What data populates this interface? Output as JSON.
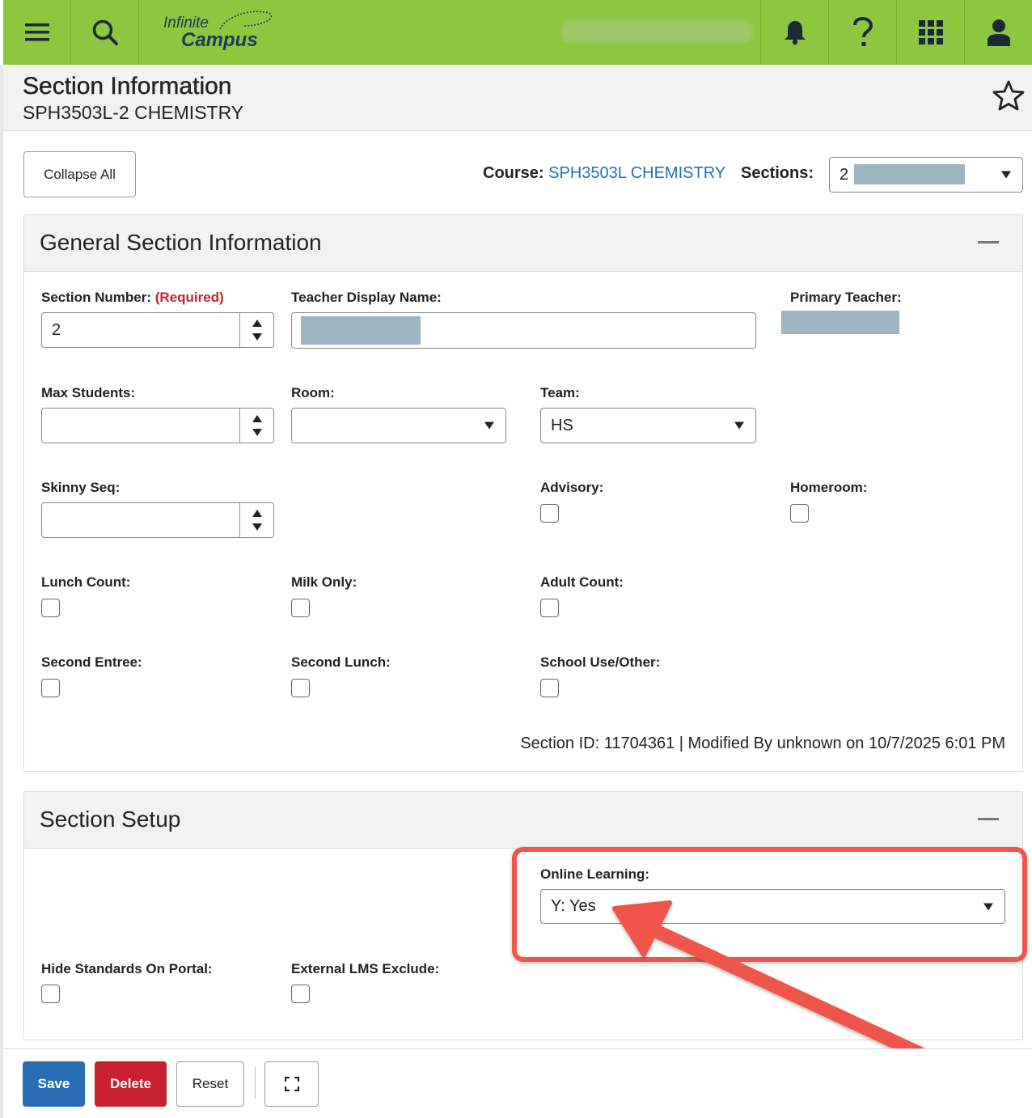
{
  "app": {
    "logo_line1": "Infinite",
    "logo_line2": "Campus"
  },
  "topbar": {
    "menu_icon": "hamburger-menu-icon",
    "search_icon": "search-icon",
    "notifications_icon": "bell-icon",
    "help_icon": "question-mark-icon",
    "apps_icon": "grid-apps-icon",
    "user_icon": "user-avatar-icon"
  },
  "header": {
    "title": "Section Information",
    "subtitle": "SPH3503L-2 CHEMISTRY",
    "favorite_icon": "star-icon"
  },
  "toolbar": {
    "collapse_all_label": "Collapse All",
    "course_label": "Course:",
    "course_link": "SPH3503L CHEMISTRY",
    "sections_label": "Sections:",
    "sections_value": "2"
  },
  "general": {
    "title": "General Section Information",
    "section_number_label": "Section Number:",
    "required_label": "(Required)",
    "section_number_value": "2",
    "teacher_display_name_label": "Teacher Display Name:",
    "primary_teacher_label": "Primary Teacher:",
    "max_students_label": "Max Students:",
    "room_label": "Room:",
    "team_label": "Team:",
    "team_value": "HS",
    "skinny_seq_label": "Skinny Seq:",
    "advisory_label": "Advisory:",
    "homeroom_label": "Homeroom:",
    "lunch_count_label": "Lunch Count:",
    "milk_only_label": "Milk Only:",
    "adult_count_label": "Adult Count:",
    "second_entree_label": "Second Entree:",
    "second_lunch_label": "Second Lunch:",
    "school_use_label": "School Use/Other:",
    "meta": "Section ID: 11704361 | Modified By unknown on 10/7/2025 6:01 PM"
  },
  "setup": {
    "title": "Section Setup",
    "online_learning_label": "Online Learning:",
    "online_learning_value": "Y: Yes",
    "hide_standards_label": "Hide Standards On Portal:",
    "external_lms_label": "External LMS Exclude:"
  },
  "footer": {
    "save_label": "Save",
    "delete_label": "Delete",
    "reset_label": "Reset",
    "fullscreen_icon": "expand-fullscreen-icon"
  },
  "colors": {
    "topbar": "#8dc63f",
    "link": "#1f6fb5",
    "required": "#c8202f",
    "save": "#2a6db5",
    "delete": "#c8202f",
    "highlight": "#f0554a"
  }
}
